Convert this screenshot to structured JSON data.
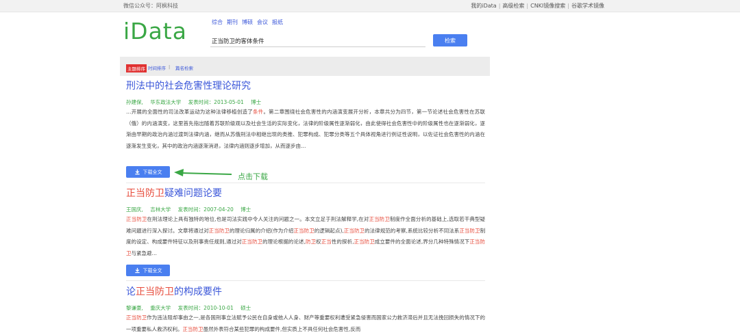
{
  "topbar": {
    "wechat": "微信公众号：阿枫科技",
    "links": [
      "我的iData",
      "高级检索",
      "CNKI镜像搜索",
      "谷歌学术镜像"
    ]
  },
  "logo": "iData",
  "categories": [
    "综合",
    "期刊",
    "博硕",
    "会议",
    "报纸"
  ],
  "search": {
    "value": "正当防卫的客体条件",
    "button": "检索"
  },
  "sort": {
    "active": "主题排序",
    "option1": "时间排序",
    "separator": "|",
    "option2": "篇名检索"
  },
  "results": [
    {
      "title": "刑法中的社会危害性理论研究",
      "author": "孙建保,",
      "school": "华东政法大学",
      "date": "发表时间：2013-05-01",
      "degree": "博士",
      "abstract_html": "…开展的全面性的司法改革运动为这种法律移植创造了<span class=\"hl\">条件</span>。第二章围绕社会危害性的内涵演变展开分析，本章共分为四节，第一节论述社会危害性在苏联（俄）的内涵演变，这里首先指出随着苏联阶级观以及社会生活的实际变化，法律的阶级属性逐渐弱化，由此使得社会危害性中的阶级属性也在逐渐弱化，逐渐由早期的政治内涵过渡到法律内涵，继而从苏俄刑法中相继出现的类推、犯罪构成、犯罪分类等五个具体视角进行例证性说明，以佐证社会危害性的内涵在逐渐发生变化，其中的政治内涵逐渐消退，法律内涵则逐步增加，从而逐步由…",
      "download": "下载全文"
    },
    {
      "title_parts": [
        "正当防卫",
        "疑难问题论要"
      ],
      "author": "王国庆,",
      "school": "吉林大学",
      "date": "发表时间：2007-04-20",
      "degree": "博士",
      "abstract_html": "<span class=\"hl\">正当防卫</span>在刑法理论上具有独特的地位,也是司法实践中令人关注的问题之一。本文立足于刑法解释学,在对<span class=\"hl\">正当防卫</span>制度作全面分析的基础上,选取若干典型疑难问题进行深入探讨。文章将通过对<span class=\"hl\">正当防卫</span>的理论归属的介绍(作为介绍<span class=\"hl\">正当防卫</span>的逻辑起点),<span class=\"hl\">正当防卫</span>的法律规范的考察,系统比较分析不同法系<span class=\"hl\">正当防卫</span>制度的设定、构成要件特征以及刑事责任规则,通过对<span class=\"hl\">正当防卫</span>的理论根据的论述,<span class=\"hl\">防卫</span>权<span class=\"hl\">正当</span>性的探析,<span class=\"hl\">正当防卫</span>成立要件的全面论述,界分几种特殊情况下<span class=\"hl\">正当防卫</span>与紧急避…",
      "download": "下载全文"
    },
    {
      "title_parts": [
        "论",
        "正当防卫",
        "的构成要件"
      ],
      "author": "黎谦豪,",
      "school": "重庆大学",
      "date": "发表时间：2010-10-01",
      "degree": "硕士",
      "abstract_html": "<span class=\"hl\">正当防卫</span>作为违法阻却事由之一,是各国刑事立法赋予公民在自身或他人人身、财产等重要权利遭受紧急侵害而国家公力救济滞后并且无法挽回损失的情况下的一项重要私人救济权利。<span class=\"hl\">正当防卫</span>虽然外表符合某些犯罪的构成要件,但实质上不具任何社会危害性,反而"
    }
  ],
  "annotation": "点击下载",
  "colors": {
    "accent": "#4a7ff0",
    "logo": "#3aa745",
    "highlight": "#e74c3c",
    "link": "#3b57d9"
  }
}
